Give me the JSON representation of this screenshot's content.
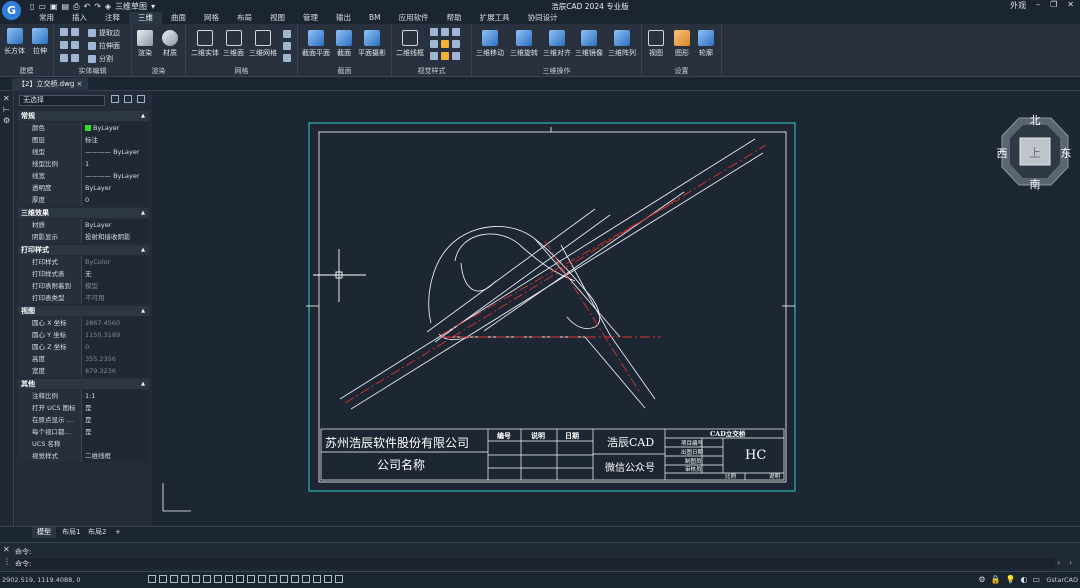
{
  "app": {
    "title": "浩辰CAD 2024 专业版",
    "workspace": "三维草图",
    "right_label": "外观"
  },
  "tabs": [
    "常用",
    "插入",
    "注释",
    "三维",
    "曲面",
    "网格",
    "布局",
    "视图",
    "管理",
    "输出",
    "BM",
    "应用软件",
    "帮助",
    "扩展工具",
    "协同设计"
  ],
  "ribbon": {
    "groups": [
      "建模",
      "实体编辑",
      "渲染",
      "网格",
      "截面",
      "视觉样式",
      "三维操作",
      "设置"
    ],
    "buttons": {
      "box": "长方体",
      "extrude": "拉伸",
      "extract_edges": "提取边",
      "extrude_face": "拉伸面",
      "separate": "分割",
      "render": "渲染",
      "material": "材质",
      "solid2": "二维实体",
      "face3": "三维面",
      "mesh3": "三维网格",
      "section_plane": "截面平面",
      "section": "截面",
      "flatshot": "平面摄影",
      "wireframe2": "二维线框",
      "move3": "三维移动",
      "rotate3": "三维旋转",
      "align3": "三维对齐",
      "mirror3": "三维镜像",
      "array3": "三维阵列",
      "view": "视图",
      "shape": "图形",
      "contour": "轮廓"
    }
  },
  "document": {
    "tab": "【2】立交桥.dwg"
  },
  "properties": {
    "selection": "无选择",
    "sections": {
      "general": "常规",
      "three_d": "三维效果",
      "plot": "打印样式",
      "view": "视图",
      "misc": "其他"
    },
    "general": [
      {
        "k": "颜色",
        "v": "ByLayer"
      },
      {
        "k": "图层",
        "v": "标注"
      },
      {
        "k": "线型",
        "v": "———— ByLayer"
      },
      {
        "k": "线型比例",
        "v": "1"
      },
      {
        "k": "线宽",
        "v": "———— ByLayer"
      },
      {
        "k": "透明度",
        "v": "ByLayer"
      },
      {
        "k": "厚度",
        "v": "0"
      }
    ],
    "three_d": [
      {
        "k": "材质",
        "v": "ByLayer"
      },
      {
        "k": "阴影显示",
        "v": "投射和接收阴影"
      }
    ],
    "plot": [
      {
        "k": "打印样式",
        "v": "ByColor"
      },
      {
        "k": "打印样式表",
        "v": "无"
      },
      {
        "k": "打印表附着到",
        "v": "模型"
      },
      {
        "k": "打印表类型",
        "v": "不可用"
      }
    ],
    "view": [
      {
        "k": "圆心 X 坐标",
        "v": "2867.4560"
      },
      {
        "k": "圆心 Y 坐标",
        "v": "1150.3189"
      },
      {
        "k": "圆心 Z 坐标",
        "v": "0"
      },
      {
        "k": "高度",
        "v": "355.2356"
      },
      {
        "k": "宽度",
        "v": "879.3236"
      }
    ],
    "misc": [
      {
        "k": "注释比例",
        "v": "1:1"
      },
      {
        "k": "打开 UCS 图标",
        "v": "是"
      },
      {
        "k": "在原点显示 …",
        "v": "是"
      },
      {
        "k": "每个视口都…",
        "v": "是"
      },
      {
        "k": "UCS 名称",
        "v": ""
      },
      {
        "k": "视觉样式",
        "v": "二维线框"
      }
    ]
  },
  "viewcube": {
    "north": "北",
    "south": "南",
    "east": "东",
    "west": "西",
    "top": "上"
  },
  "titleblock": {
    "company": "苏州浩辰软件股份有限公司",
    "company_label": "公司名称",
    "col_no": "编号",
    "col_desc": "说明",
    "col_date": "日期",
    "brand": "浩辰CAD",
    "wechat": "微信公众号",
    "drawing": "CAD立交桥",
    "project_no": "项目编号",
    "issue_date": "出图日期",
    "drawn": "制图员",
    "checked": "审核员",
    "mark": "HC",
    "scale": "比例",
    "note": "说明"
  },
  "layout_tabs": [
    "模型",
    "布局1",
    "布局2",
    "+"
  ],
  "command": {
    "line1": "命令:",
    "line2": "命令:"
  },
  "status": {
    "coords": "2902.519, 1119.4088, 0",
    "app": "GstarCAD"
  }
}
